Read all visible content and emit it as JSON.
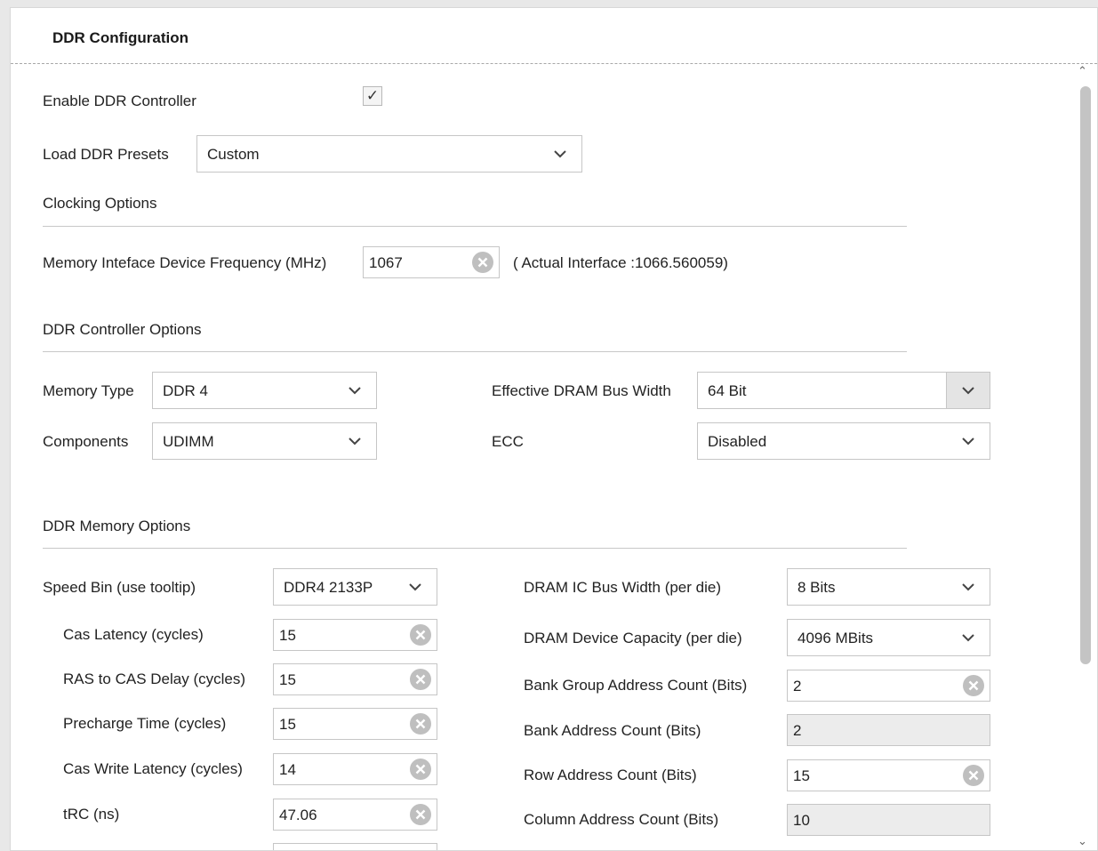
{
  "header": {
    "title": "DDR Configuration"
  },
  "enable_ddr": {
    "label": "Enable DDR Controller",
    "checked_glyph": "✓"
  },
  "presets": {
    "label": "Load DDR Presets",
    "value": "Custom"
  },
  "clocking": {
    "section_title": "Clocking Options",
    "freq_label": "Memory Inteface Device Frequency (MHz)",
    "freq_value": "1067",
    "actual_text": "( Actual Interface :1066.560059)"
  },
  "controller": {
    "section_title": "DDR Controller Options",
    "memory_type_label": "Memory Type",
    "memory_type_value": "DDR 4",
    "components_label": "Components",
    "components_value": "UDIMM",
    "bus_width_label": "Effective DRAM Bus Width",
    "bus_width_value": "64 Bit",
    "ecc_label": "ECC",
    "ecc_value": "Disabled"
  },
  "memory": {
    "section_title": "DDR Memory Options",
    "speed_bin_label": "Speed Bin (use tooltip)",
    "speed_bin_value": "DDR4 2133P",
    "left_fields": [
      {
        "label": "Cas Latency (cycles)",
        "value": "15"
      },
      {
        "label": "RAS to CAS Delay (cycles)",
        "value": "15"
      },
      {
        "label": "Precharge Time (cycles)",
        "value": "15"
      },
      {
        "label": "Cas Write Latency (cycles)",
        "value": "14"
      },
      {
        "label": "tRC (ns)",
        "value": "47.06"
      }
    ],
    "ic_bus_width_label": "DRAM IC Bus Width (per die)",
    "ic_bus_width_value": "8 Bits",
    "capacity_label": "DRAM Device Capacity (per die)",
    "capacity_value": "4096 MBits",
    "right_fields": [
      {
        "label": "Bank Group Address Count (Bits)",
        "value": "2",
        "disabled": false
      },
      {
        "label": "Bank Address Count (Bits)",
        "value": "2",
        "disabled": true
      },
      {
        "label": "Row Address Count (Bits)",
        "value": "15",
        "disabled": false
      },
      {
        "label": "Column Address Count (Bits)",
        "value": "10",
        "disabled": true
      }
    ]
  },
  "icons": {
    "dropdown": "chevron-down-icon",
    "clear": "clear-circle-icon"
  },
  "colors": {
    "border": "#c6c6c6",
    "disabled_bg": "#ececec",
    "scroll_thumb": "#c4c4c4"
  }
}
